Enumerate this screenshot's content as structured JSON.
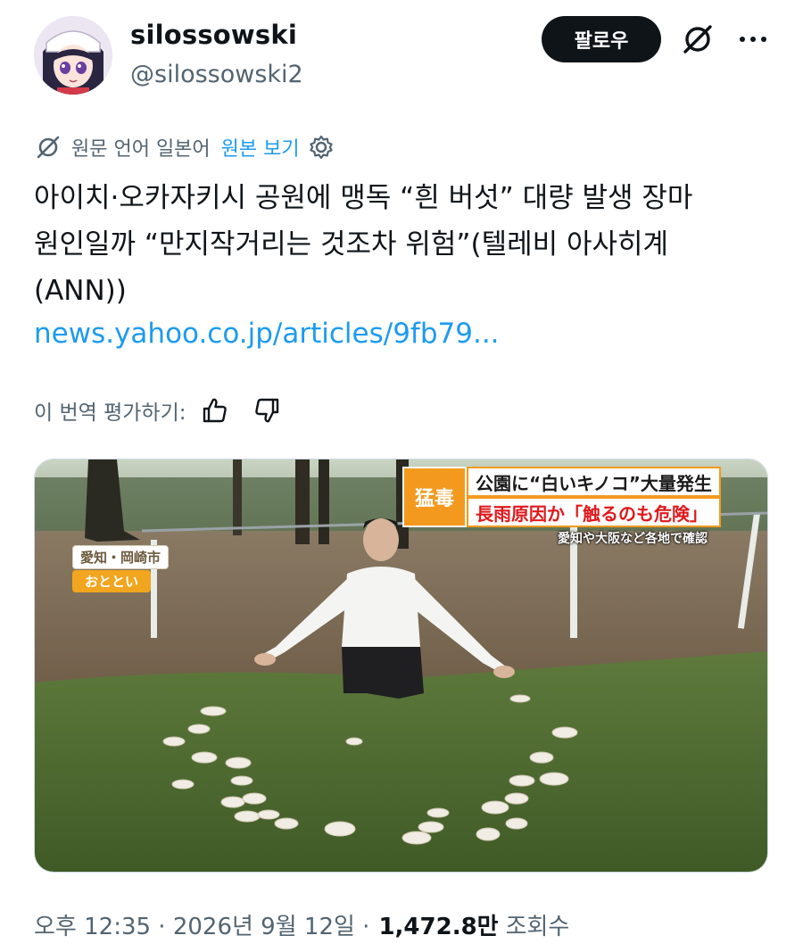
{
  "user": {
    "display_name": "silossowski",
    "handle": "@silossowski2",
    "follow_label": "팔로우",
    "avatar_icon": "anime-avatar-icon"
  },
  "translation": {
    "source_label": "원문 언어 일본어",
    "show_original": "원본 보기"
  },
  "tweet": {
    "lines": [
      "아이치·오카자키시 공원에 맹독 “흰 버섯” 대량 발생 장마",
      "원인일까 “만지작거리는 것조차 위험”(텔레비 아사히계",
      "(ANN))"
    ],
    "link": "news.yahoo.co.jp/articles/9fb79..."
  },
  "rate": {
    "label": "이 번역 평가하기:"
  },
  "media": {
    "badge": "猛毒",
    "headline_1": "公園に“白いキノコ”大量発生",
    "headline_2": "長雨原因か「触るのも危険」",
    "subcaption": "愛知や大阪など各地で確認",
    "location": "愛知・岡崎市",
    "date": "おととい"
  },
  "meta": {
    "time": "오후 12:35 · 2026년 9월 12일 ·",
    "views": "1,472.8만",
    "views_label": "조회수"
  },
  "colors": {
    "accent": "#1d9bf0",
    "text": "#0f1419",
    "secondary": "#536471",
    "caption_orange": "#f39a1e",
    "caption_red": "#e0181b"
  }
}
